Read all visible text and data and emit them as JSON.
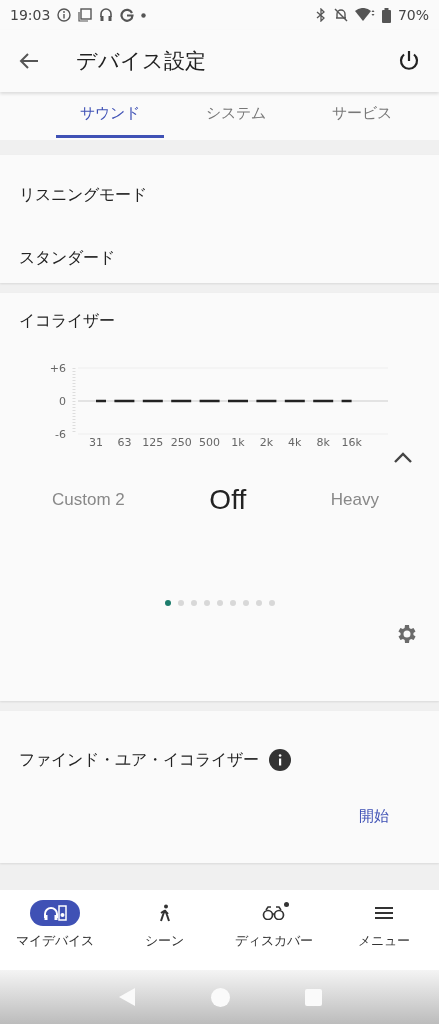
{
  "status_bar": {
    "time": "19:03",
    "battery": "70%"
  },
  "header": {
    "title": "デバイス設定"
  },
  "tabs": [
    {
      "label": "サウンド",
      "selected": true
    },
    {
      "label": "システム",
      "selected": false
    },
    {
      "label": "サービス",
      "selected": false
    }
  ],
  "listening_mode": {
    "title": "リスニングモード",
    "value": "スタンダード"
  },
  "equalizer": {
    "title": "イコライザー",
    "expanded": true,
    "chart_data": {
      "type": "line",
      "categories": [
        "31",
        "63",
        "125",
        "250",
        "500",
        "1k",
        "2k",
        "4k",
        "8k",
        "16k"
      ],
      "yticks": [
        {
          "value": 6,
          "label": "+6"
        },
        {
          "value": 0,
          "label": "0"
        },
        {
          "value": -6,
          "label": "-6"
        }
      ],
      "ylim": [
        -6,
        6
      ],
      "series": [
        {
          "color": "#222222",
          "line_style": "dashed",
          "values": [
            0,
            0,
            0,
            0,
            0,
            0,
            0,
            0,
            0,
            0
          ]
        }
      ]
    },
    "presets": [
      {
        "label": "Custom 2",
        "selected": false
      },
      {
        "label": "Off",
        "selected": true
      },
      {
        "label": "Heavy",
        "selected": false
      }
    ],
    "pager": [
      {
        "selected": true
      },
      {
        "selected": false
      },
      {
        "selected": false
      },
      {
        "selected": false
      },
      {
        "selected": false
      },
      {
        "selected": false
      },
      {
        "selected": false
      },
      {
        "selected": false
      },
      {
        "selected": false
      }
    ]
  },
  "find_eq": {
    "title": "ファインド・ユア・イコライザー",
    "action": "開始"
  },
  "bottom_nav": [
    {
      "label": "マイデバイス",
      "selected": true,
      "badge": false
    },
    {
      "label": "シーン",
      "selected": false,
      "badge": false
    },
    {
      "label": "ディスカバー",
      "selected": false,
      "badge": true
    },
    {
      "label": "メニュー",
      "selected": false,
      "badge": false
    }
  ]
}
